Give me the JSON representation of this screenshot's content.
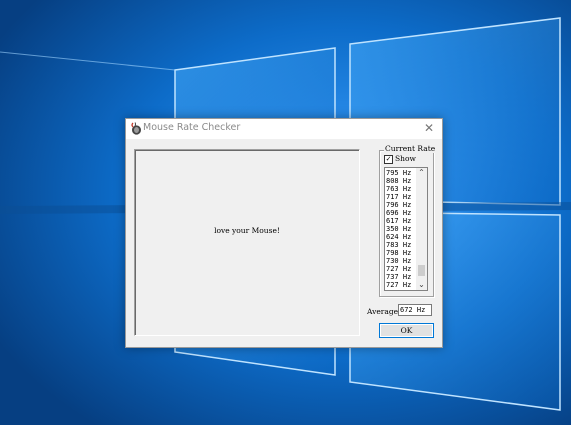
{
  "window": {
    "title": "Mouse Rate Checker",
    "close_glyph": "✕"
  },
  "canvas": {
    "message": "love your Mouse!"
  },
  "current_rate": {
    "group_label": "Current Rate",
    "show_label": "Show",
    "show_checked": true,
    "check_glyph": "✓",
    "rates": [
      "795 Hz",
      "808 Hz",
      "763 Hz",
      "717 Hz",
      "796 Hz",
      "696 Hz",
      "617 Hz",
      "350 Hz",
      "624 Hz",
      "783 Hz",
      "798 Hz",
      "730 Hz",
      "727 Hz",
      "737 Hz",
      "727 Hz"
    ],
    "scroll_up_glyph": "⌃",
    "scroll_down_glyph": "⌄"
  },
  "average": {
    "label": "Average",
    "value": "672 Hz"
  },
  "ok_label": "OK",
  "colors": {
    "desktop": "#0b5fb0",
    "window_bg": "#f0f0f0",
    "button_focus": "#0078d7"
  },
  "icons": [
    "mouse-app-icon",
    "close-icon",
    "checkbox-icon",
    "scroll-up-icon",
    "scroll-down-icon"
  ]
}
